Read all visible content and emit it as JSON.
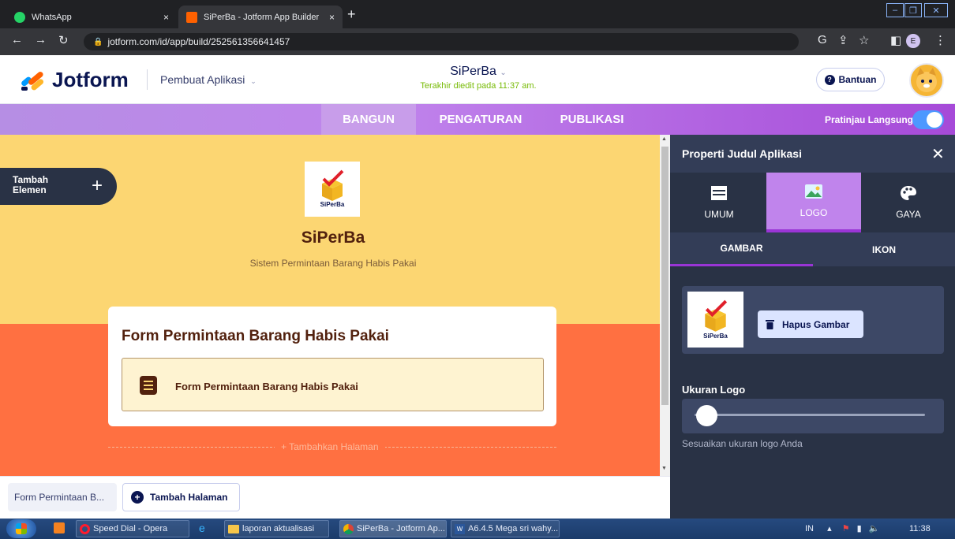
{
  "browser": {
    "tabs": [
      {
        "label": "WhatsApp",
        "close": "×"
      },
      {
        "label": "SiPerBa - Jotform App Builder",
        "close": "×"
      }
    ],
    "new_tab": "+",
    "url": "jotform.com/id/app/build/252561356641457",
    "profile_initial": "E"
  },
  "header": {
    "logo": "Jotform",
    "maker": "Pembuat Aplikasi",
    "app_title": "SiPerBa",
    "last_edited": "Terakhir diedit pada 11:37 am.",
    "help": "Bantuan"
  },
  "nav": {
    "tabs": [
      "BANGUN",
      "PENGATURAN",
      "PUBLIKASI"
    ],
    "active": "BANGUN",
    "preview_label": "Pratinjau Langsung",
    "preview_on": true
  },
  "canvas": {
    "add_element": "Tambah Elemen",
    "logo_caption": "SiPerBa",
    "app_name": "SiPerBa",
    "app_subtitle": "Sistem Permintaan Barang Habis Pakai",
    "card_title": "Form Permintaan Barang Habis Pakai",
    "form_item": "Form Permintaan Barang Habis Pakai",
    "add_page_link": "+ Tambahkan Halaman"
  },
  "page_tabs": {
    "current": "Form Permintaan B...",
    "add": "Tambah Halaman"
  },
  "panel": {
    "title": "Properti Judul Aplikasi",
    "tabs": [
      "UMUM",
      "LOGO",
      "GAYA"
    ],
    "active_tab": "LOGO",
    "subtabs": [
      "GAMBAR",
      "IKON"
    ],
    "active_subtab": "GAMBAR",
    "thumb_caption": "SiPerBa",
    "delete_image": "Hapus Gambar",
    "logo_size_label": "Ukuran Logo",
    "logo_size_hint": "Sesuaikan ukuran logo Anda",
    "logo_size_value": 0.05
  },
  "taskbar": {
    "items": [
      "Speed Dial - Opera",
      "laporan aktualisasi",
      "SiPerBa - Jotform Ap...",
      "A6.4.5 Mega sri wahy..."
    ],
    "language": "IN",
    "time": "11:38"
  },
  "colors": {
    "canvas_top": "#fcd672",
    "canvas_bottom": "#ff7041",
    "panel_bg": "#293245",
    "accent_purple": "#c084ec",
    "title_brown": "#52210e"
  }
}
